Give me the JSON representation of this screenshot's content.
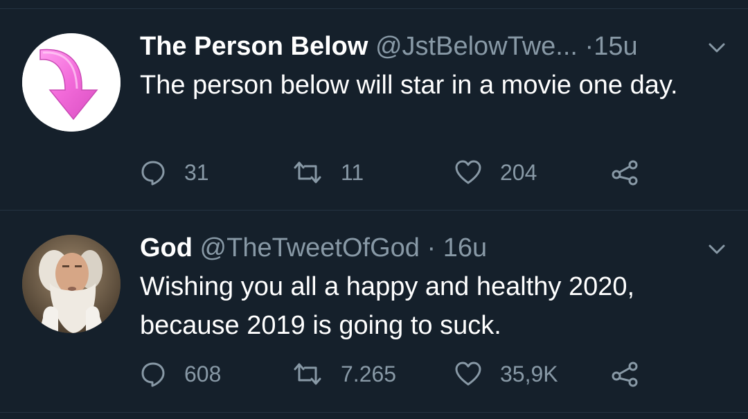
{
  "tweets": [
    {
      "display_name": "The Person Below",
      "handle": "@JstBelowTwe...",
      "separator": "·",
      "time": "15u",
      "text": "The person below will star in a movie one day.",
      "avatar_icon": "pink-arrow-down-icon",
      "stats": {
        "replies": "31",
        "retweets": "11",
        "likes": "204"
      }
    },
    {
      "display_name": "God",
      "handle": "@TheTweetOfGod",
      "separator": "·",
      "time": "16u",
      "text": "Wishing you all a happy and healthy 2020, because 2019 is going to suck.",
      "avatar_icon": "bearded-man-portrait",
      "stats": {
        "replies": "608",
        "retweets": "7.265",
        "likes": "35,9K"
      }
    }
  ],
  "colors": {
    "background": "#15202b",
    "divider": "#253341",
    "secondary_text": "#8899a6",
    "primary_text": "#ffffff",
    "avatar_arrow": "#f06ad8"
  },
  "icons": {
    "reply": "speech-bubble-icon",
    "retweet": "retweet-icon",
    "like": "heart-icon",
    "share": "share-icon",
    "menu": "chevron-down-icon"
  }
}
